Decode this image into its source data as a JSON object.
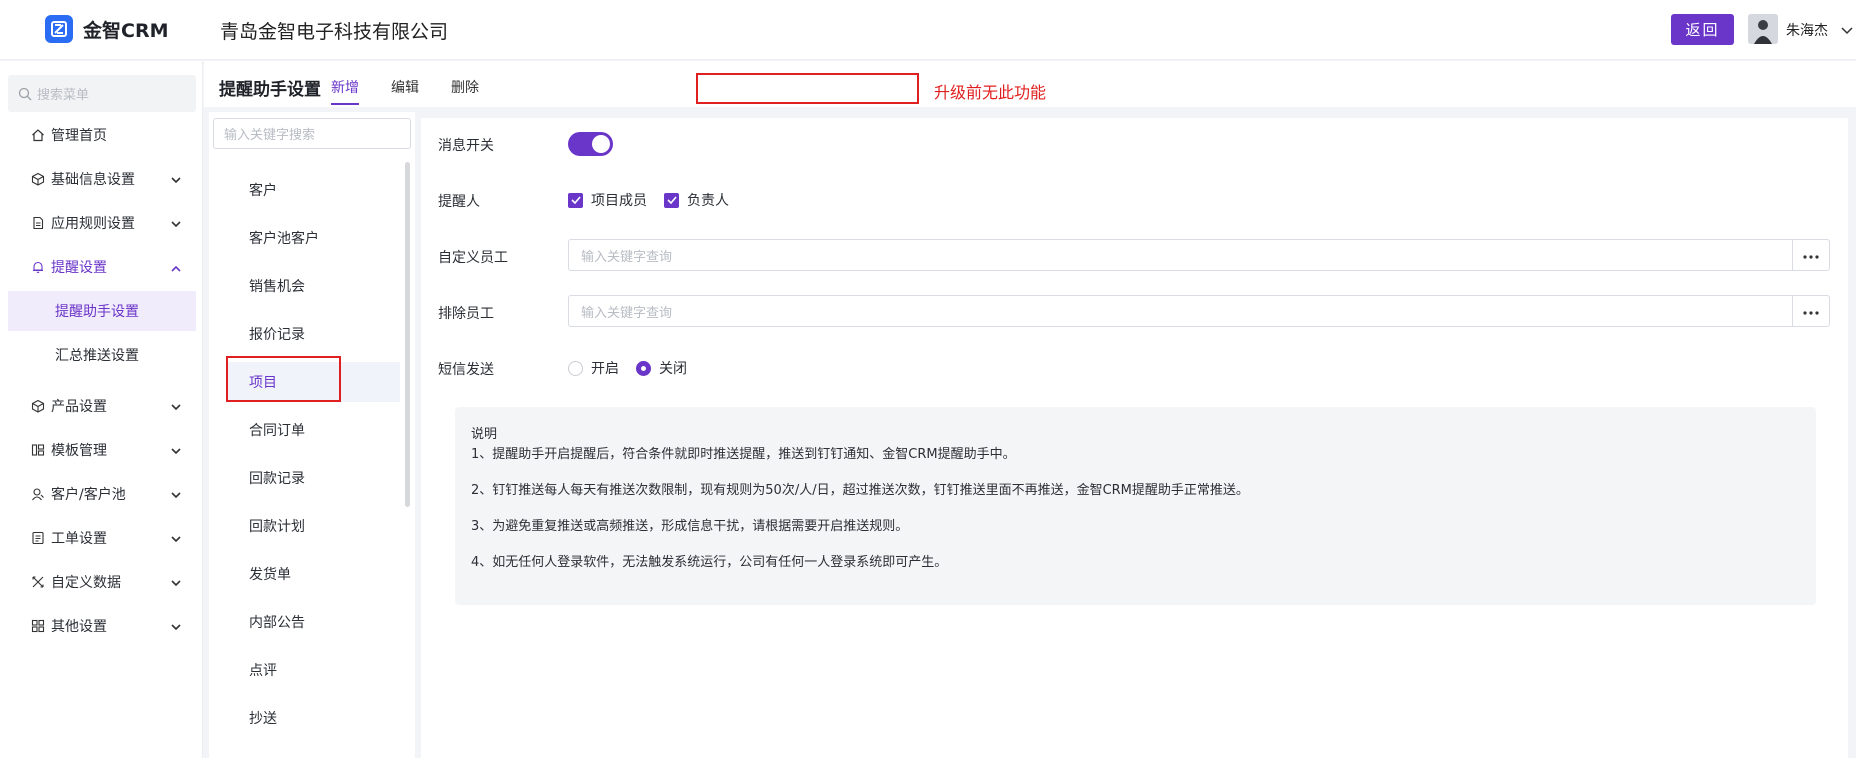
{
  "header": {
    "app_name": "金智CRM",
    "company": "青岛金智电子科技有限公司",
    "back_label": "返回",
    "user_name": "朱海杰"
  },
  "leftnav": {
    "search_placeholder": "搜索菜单",
    "items": [
      {
        "label": "管理首页",
        "icon": "home-icon"
      },
      {
        "label": "基础信息设置",
        "icon": "cube-icon"
      },
      {
        "label": "应用规则设置",
        "icon": "document-icon"
      },
      {
        "label": "提醒设置",
        "icon": "bell-icon"
      },
      {
        "label": "产品设置",
        "icon": "cube-icon"
      },
      {
        "label": "模板管理",
        "icon": "template-icon"
      },
      {
        "label": "客户/客户池",
        "icon": "customer-icon"
      },
      {
        "label": "工单设置",
        "icon": "ticket-icon"
      },
      {
        "label": "自定义数据",
        "icon": "tools-icon"
      },
      {
        "label": "其他设置",
        "icon": "apps-icon"
      }
    ],
    "subitems": [
      {
        "label": "提醒助手设置"
      },
      {
        "label": "汇总推送设置"
      }
    ]
  },
  "tabbar": {
    "title": "提醒助手设置",
    "tabs": [
      {
        "label": "新增"
      },
      {
        "label": "编辑"
      },
      {
        "label": "删除"
      }
    ],
    "note": "升级前无此功能"
  },
  "sublist": {
    "search_placeholder": "输入关键字搜索",
    "items": [
      {
        "label": "客户"
      },
      {
        "label": "客户池客户"
      },
      {
        "label": "销售机会"
      },
      {
        "label": "报价记录"
      },
      {
        "label": "项目"
      },
      {
        "label": "合同订单"
      },
      {
        "label": "回款记录"
      },
      {
        "label": "回款计划"
      },
      {
        "label": "发货单"
      },
      {
        "label": "内部公告"
      },
      {
        "label": "点评"
      },
      {
        "label": "抄送"
      }
    ]
  },
  "settings": {
    "msg_switch_label": "消息开关",
    "msg_switch_on": true,
    "reminder_label": "提醒人",
    "reminder_options": [
      {
        "label": "项目成员",
        "checked": true
      },
      {
        "label": "负责人",
        "checked": true
      }
    ],
    "custom_staff_label": "自定义员工",
    "custom_staff_placeholder": "输入关键字查询",
    "exclude_staff_label": "排除员工",
    "exclude_staff_placeholder": "输入关键字查询",
    "sms_label": "短信发送",
    "sms_options": [
      {
        "label": "开启",
        "selected": false
      },
      {
        "label": "关闭",
        "selected": true
      }
    ]
  },
  "notes": {
    "title": "说明",
    "lines": [
      "1、提醒助手开启提醒后，符合条件就即时推送提醒，推送到钉钉通知、金智CRM提醒助手中。",
      "2、钉钉推送每人每天有推送次数限制，现有规则为50次/人/日，超过推送次数，钉钉推送里面不再推送，金智CRM提醒助手正常推送。",
      "3、为避免重复推送或高频推送，形成信息干扰，请根据需要开启推送规则。",
      "4、如无任何人登录软件，无法触发系统运行，公司有任何一人登录系统即可产生。"
    ]
  },
  "colors": {
    "accent": "#6a35c9",
    "brand_logo": "#2a6df4",
    "annotation_red": "#e02020"
  }
}
